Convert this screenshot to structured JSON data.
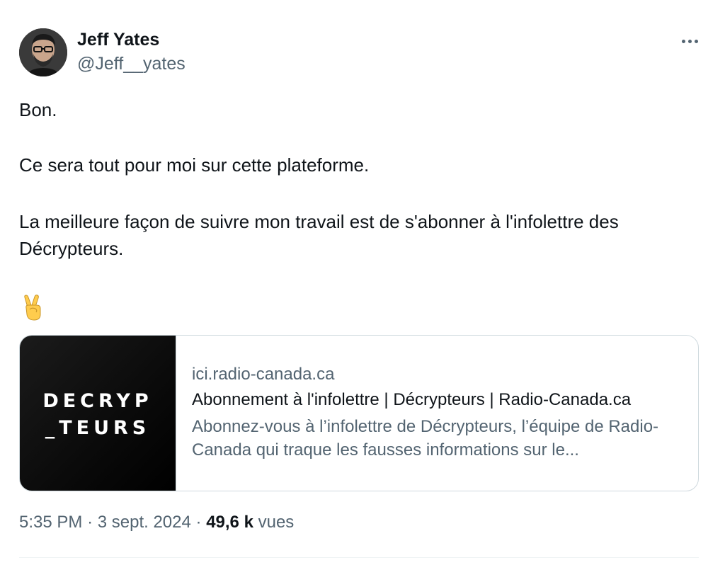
{
  "author": {
    "display_name": "Jeff Yates",
    "handle": "@Jeff__yates"
  },
  "tweet": {
    "paragraphs": [
      "Bon.",
      "Ce sera tout pour moi sur cette plateforme.",
      "La meilleure façon de suivre mon travail est de s'abonner à l'infolettre des Décrypteurs."
    ],
    "emoji": "✌️"
  },
  "link_card": {
    "image_logo_line1": "DECRYP",
    "image_logo_line2": "_TEURS",
    "domain": "ici.radio-canada.ca",
    "title": "Abonnement à l'infolettre | Décrypteurs | Radio-Canada.ca",
    "description": "Abonnez-vous à l’infolettre de Décrypteurs, l’équipe de Radio-Canada qui traque les fausses informations sur le..."
  },
  "meta": {
    "time": "5:35 PM",
    "separator": "·",
    "date": "3 sept. 2024",
    "views_count": "49,6 k",
    "views_label": "vues"
  },
  "icons": {
    "more": "more-horizontal-icon",
    "emoji": "victory-hand-icon"
  },
  "colors": {
    "text_primary": "#0f1419",
    "text_secondary": "#536471",
    "border": "#cfd9de"
  }
}
